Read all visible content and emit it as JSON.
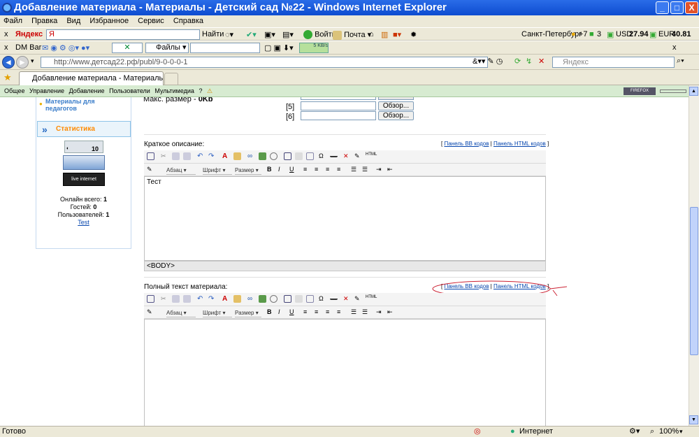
{
  "window": {
    "title": "Добавление материала - Материалы - Детский сад №22 - Windows Internet Explorer",
    "min": "_",
    "max": "□",
    "close": "X"
  },
  "menu": [
    "Файл",
    "Правка",
    "Вид",
    "Избранное",
    "Сервис",
    "Справка"
  ],
  "yandex_bar": {
    "close": "x",
    "brand": "Яндекс",
    "search_value": "Я",
    "find": "Найти",
    "login": "Войти",
    "mail": "Почта",
    "city": "Санкт-Петербург",
    "temp": "+7",
    "mail_count": "3",
    "usd_label": "USD",
    "usd": "27.94",
    "eur_label": "EUR",
    "eur": "40.81"
  },
  "dm_bar": {
    "close": "x",
    "label": "DM Bar",
    "files": "Файлы",
    "speed": "5 KB/s"
  },
  "address": {
    "url": "http://www.детсад22.рф/publ/9-0-0-0-1",
    "search_placeholder": "Яндекс"
  },
  "tab": {
    "title": "Добавление материала - Материалы - Дет..."
  },
  "admin_bar": {
    "items": [
      "Общее",
      "Управление",
      "Добавление",
      "Пользователи",
      "Мультимедиа",
      "?"
    ],
    "firefox": "FIREFOX"
  },
  "sidebar": {
    "materials_link": "Материалы для педагогов",
    "stats_title": "Статистика",
    "counter_value": "10",
    "online_label": "Онлайн всего:",
    "online": "1",
    "guests_label": "Гостей:",
    "guests": "0",
    "users_label": "Пользователей:",
    "users": "1",
    "user": "Test",
    "liveinternet": "live internet"
  },
  "upload": {
    "max_size_label": "Макс. размер -",
    "max_size": "0Kb",
    "rows": [
      "[5]",
      "[6]"
    ],
    "browse": "Обзор..."
  },
  "editor_short": {
    "label": "Краткое описание:",
    "bb_panel": "Панель BB кодов",
    "html_panel": "Панель HTML кодов",
    "content": "Тест",
    "path": "<BODY>"
  },
  "editor_full": {
    "label": "Полный текст материала:",
    "bb_panel": "Панель BB кодов",
    "html_panel": "Панель HTML кодов"
  },
  "editor_selects": {
    "paragraph": "Абзац",
    "font": "Шрифт",
    "size": "Размер"
  },
  "status": {
    "left": "Готово",
    "zone": "Интернет",
    "zoom": "100%"
  },
  "colors": {
    "title_blue": "#0d4cd0",
    "accent_green": "#d7ebd1",
    "annotation_red": "#cc2233"
  }
}
